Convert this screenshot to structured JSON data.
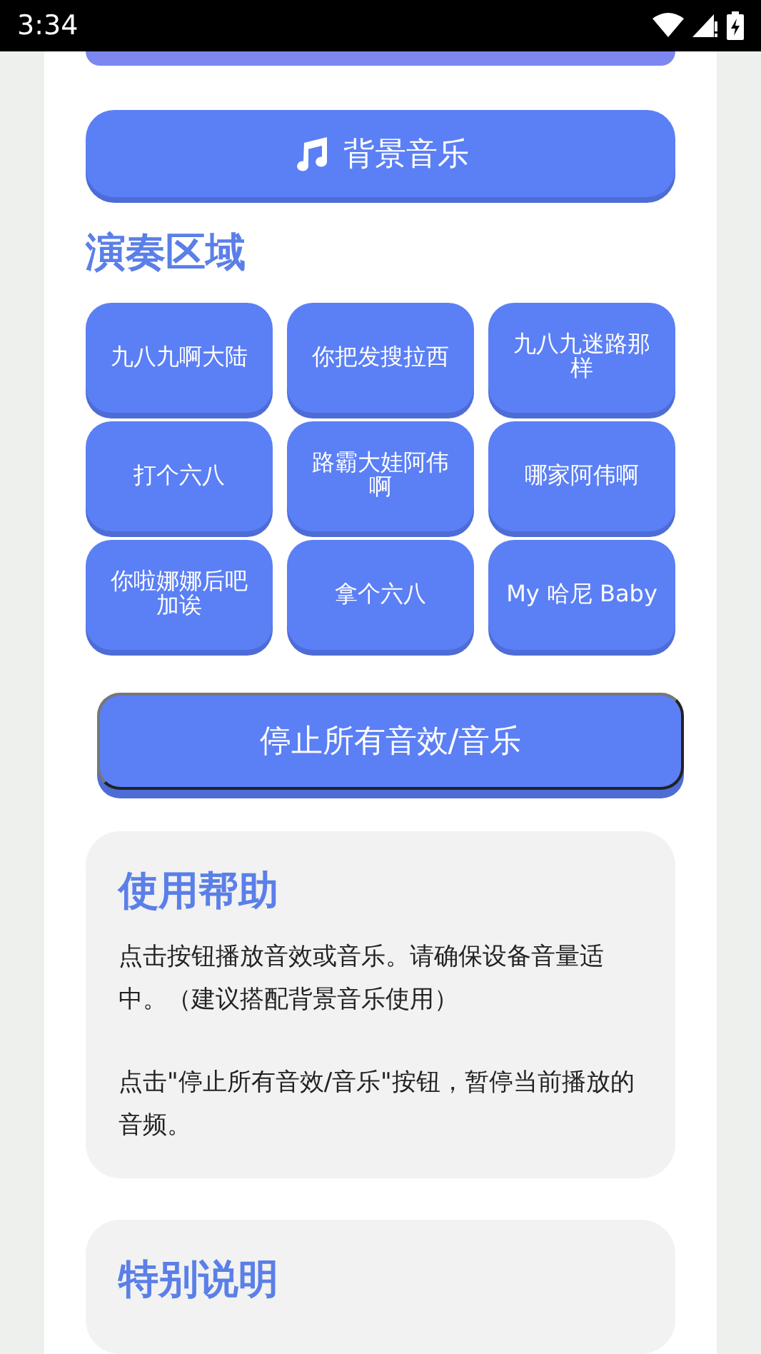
{
  "status_bar": {
    "time": "3:34"
  },
  "bgm_button": {
    "label": "背景音乐"
  },
  "play_area": {
    "title": "演奏区域",
    "pads": [
      {
        "label": "九八九啊大陆"
      },
      {
        "label": "你把发搜拉西"
      },
      {
        "label": "九八九迷路那样"
      },
      {
        "label": "打个六八"
      },
      {
        "label": "路霸大娃阿伟啊"
      },
      {
        "label": "哪家阿伟啊"
      },
      {
        "label": "你啦娜娜后吧加诶"
      },
      {
        "label": "拿个六八"
      },
      {
        "label": "My 哈尼 Baby"
      }
    ]
  },
  "stop_button": {
    "label": "停止所有音效/音乐"
  },
  "cards": [
    {
      "title": "使用帮助",
      "paragraphs": [
        "点击按钮播放音效或音乐。请确保设备音量适中。（建议搭配背景音乐使用）",
        "点击\"停止所有音效/音乐\"按钮，暂停当前播放的音频。"
      ]
    },
    {
      "title": "特别说明"
    }
  ]
}
